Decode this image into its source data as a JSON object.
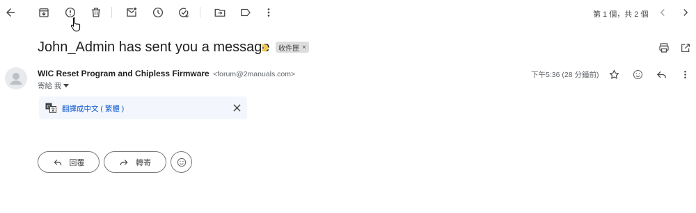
{
  "toolbar": {
    "icons": [
      "back-arrow-icon",
      "archive-icon",
      "report-spam-icon",
      "delete-icon",
      "mark-unread-icon",
      "snooze-icon",
      "add-to-tasks-icon",
      "move-to-icon",
      "label-icon",
      "more-vert-icon"
    ],
    "pager_text": "第 1 個，共 2 個"
  },
  "message": {
    "subject": "John_Admin has sent you a message",
    "label_chip": "收件匣",
    "label_chip_close": "×",
    "sender_name": "WIC Reset Program and Chipless Firmware",
    "sender_email": "<forum@2manuals.com>",
    "to_line": "寄給 我",
    "timestamp": "下午5:36 (28 分鐘前)"
  },
  "translate": {
    "link_text": "翻譯成中文 ( 繁體 )"
  },
  "actions": {
    "reply_label": "回覆",
    "forward_label": "轉寄"
  },
  "colors": {
    "accent_blue": "#0b57d0",
    "importance_marker": "#f2c94c",
    "translate_bg": "#f3f6fc",
    "chip_bg": "#dddddd"
  }
}
